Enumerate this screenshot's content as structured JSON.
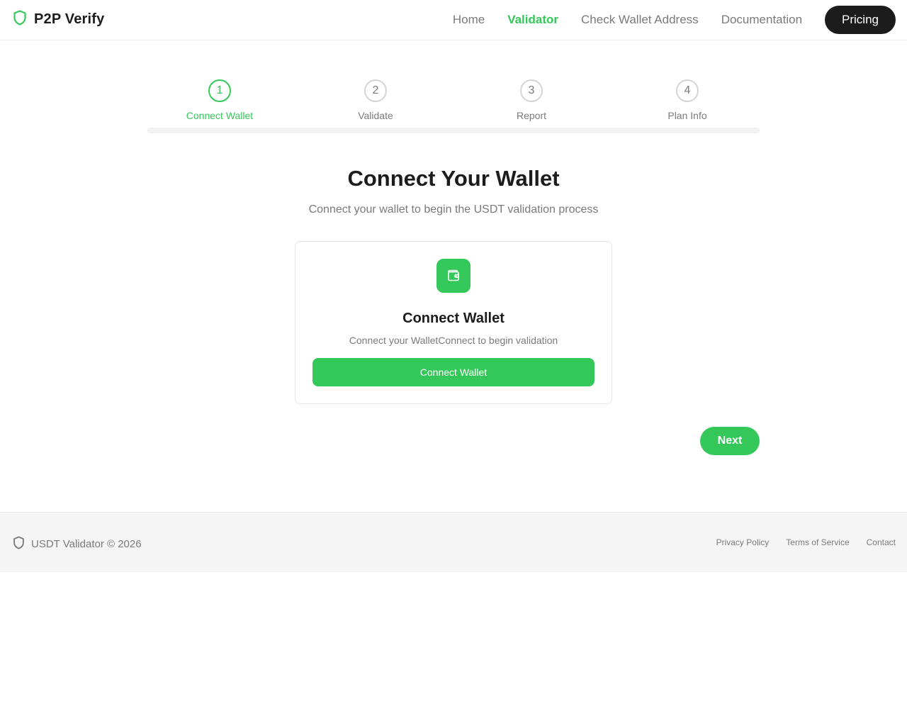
{
  "header": {
    "brand_name": "P2P Verify",
    "brand_icon": "shield-icon",
    "nav": {
      "home": "Home",
      "validator": "Validator",
      "check_wallet": "Check Wallet Address",
      "documentation": "Documentation",
      "pricing": "Pricing"
    },
    "active_nav": "Validator"
  },
  "stepper": {
    "steps": [
      {
        "number": "1",
        "label": "Connect Wallet",
        "active": true
      },
      {
        "number": "2",
        "label": "Validate",
        "active": false
      },
      {
        "number": "3",
        "label": "Report",
        "active": false
      },
      {
        "number": "4",
        "label": "Plan Info",
        "active": false
      }
    ],
    "progress": 0
  },
  "main": {
    "title": "Connect Your Wallet",
    "subtitle": "Connect your wallet to begin the USDT validation process",
    "card": {
      "icon": "wallet-icon",
      "title": "Connect Wallet",
      "description": "Connect your WalletConnect to begin validation",
      "button_label": "Connect Wallet"
    },
    "next_label": "Next"
  },
  "footer": {
    "brand_text": "USDT Validator © 2026",
    "brand_icon": "shield-icon",
    "links": {
      "privacy": "Privacy Policy",
      "terms": "Terms of Service",
      "contact": "Contact"
    }
  },
  "colors": {
    "accent": "#34c759",
    "dark": "#1c1c1c",
    "muted": "#7a7a7a"
  }
}
